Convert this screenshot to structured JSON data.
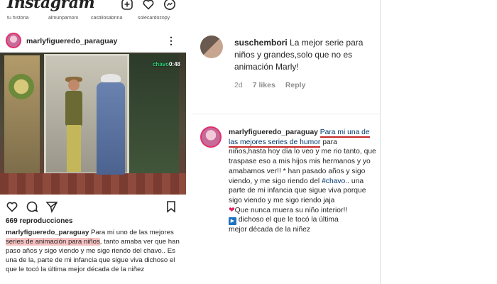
{
  "app": {
    "logo_text": "Instagram"
  },
  "top_icons": [
    "add-post-icon",
    "heart-icon",
    "messenger-icon"
  ],
  "stories": [
    "tu historia",
    "almunpamoni",
    "castillosabrina",
    "solecardozopy"
  ],
  "post": {
    "username": "marlyfigueredo_paraguay",
    "more_label": "⋮",
    "video_watermark": {
      "brand": "chavo",
      "tail": "0:48"
    },
    "views": "669 reproducciones",
    "caption": {
      "username": "marlyfigueredo_paraguay",
      "part1": " Para mi uno de las mejores ",
      "highlight": "series de animación para niños",
      "part2": ", tanto amaba ver que han paso años y sigo viendo y me sigo riendo del chavo.. Es una de la, parte de mi infancia que sigue viva dichoso el que le tocó la última mejor década de la niñez"
    }
  },
  "comments": [
    {
      "username": "suschembori",
      "text": " La mejor serie para niños y grandes,solo que no es animación Marly!",
      "age": "2d",
      "likes": "7 likes",
      "reply": "Reply"
    },
    {
      "username": "marlyfigueredo_paraguay",
      "link_text": "Para mi una de las mejores series de humor",
      "text1": " para niños,hasta hoy día lo veo y me rio tanto, que traspase eso a mis hijos mis hermanos y yo amabamos ver!! * han pasado años y sigo viendo, y me sigo riendo del ",
      "hashtag": "#chavo",
      "text2": ".. una parte de mi infancia que sigue viva porque sigo viendo y me sigo riendo jaja",
      "line2": "Que nunca muera su niño interior!!",
      "line3": " dichoso el que le tocó la última",
      "line4": "mejor década de la niñez"
    }
  ],
  "colors": {
    "highlight": "#f8c3c3",
    "underline": "#c62828",
    "link": "#00376b",
    "accent": "#e1306c"
  }
}
